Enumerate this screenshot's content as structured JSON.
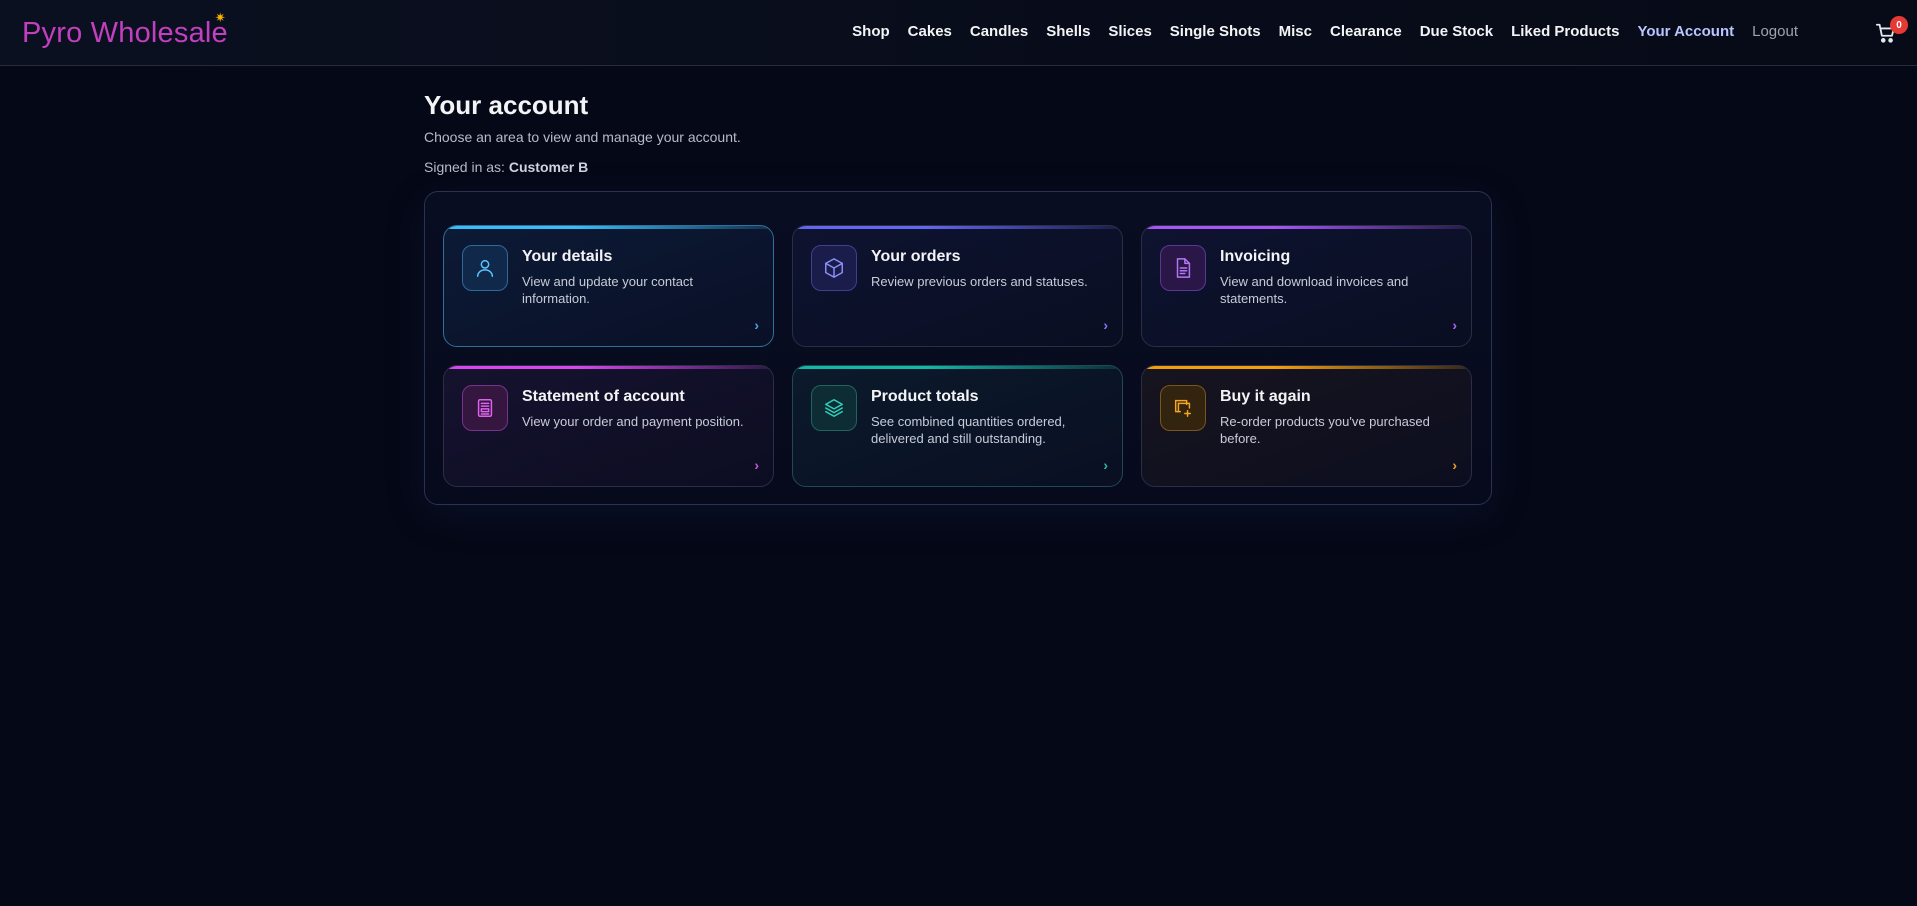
{
  "header": {
    "logo": "Pyro Wholesale",
    "nav": [
      {
        "label": "Shop"
      },
      {
        "label": "Cakes"
      },
      {
        "label": "Candles"
      },
      {
        "label": "Shells"
      },
      {
        "label": "Slices"
      },
      {
        "label": "Single Shots"
      },
      {
        "label": "Misc"
      },
      {
        "label": "Clearance"
      },
      {
        "label": "Due Stock"
      },
      {
        "label": "Liked Products"
      },
      {
        "label": "Your Account"
      },
      {
        "label": "Logout"
      }
    ],
    "cart_count": "0"
  },
  "main": {
    "title": "Your account",
    "subtitle": "Choose an area to view and manage your account.",
    "signed_in_label": "Signed in as:",
    "signed_in_user": "Customer B"
  },
  "cards": [
    {
      "title": "Your details",
      "description": "View and update your contact information.",
      "icon": "user-icon",
      "color": "#38bdf8"
    },
    {
      "title": "Your orders",
      "description": "Review previous orders and statuses.",
      "icon": "box-icon",
      "color": "#6366f1"
    },
    {
      "title": "Invoicing",
      "description": "View and download invoices and statements.",
      "icon": "document-icon",
      "color": "#a855f7"
    },
    {
      "title": "Statement of account",
      "description": "View your order and payment position.",
      "icon": "statement-icon",
      "color": "#d946ef"
    },
    {
      "title": "Product totals",
      "description": "See combined quantities ordered, delivered and still outstanding.",
      "icon": "layers-icon",
      "color": "#14b8a6"
    },
    {
      "title": "Buy it again",
      "description": "Re-order products you've purchased before.",
      "icon": "reorder-icon",
      "color": "#f59e0b"
    }
  ]
}
